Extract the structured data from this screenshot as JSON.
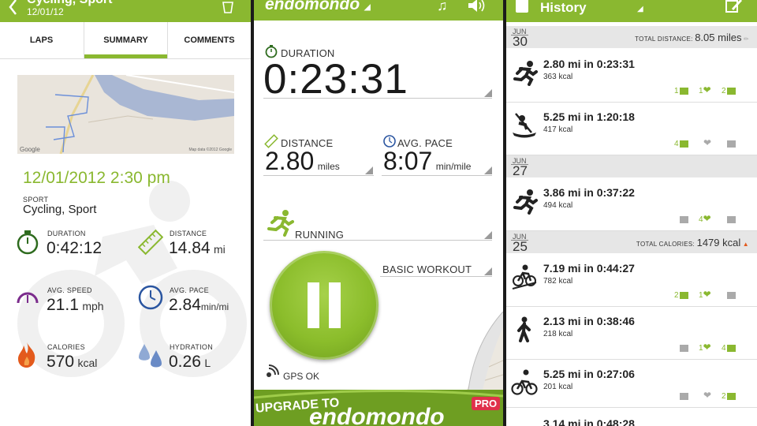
{
  "panel1": {
    "title": "Cycling, Sport",
    "subtitle": "12/01/12",
    "tabs": [
      "LAPS",
      "SUMMARY",
      "COMMENTS"
    ],
    "active_tab": "SUMMARY",
    "map_google_label": "Google",
    "map_copyright": "Map data ©2012 Google",
    "datetime": "12/01/2012 2:30 pm",
    "sport_label": "SPORT",
    "sport_value": "Cycling, Sport",
    "stats": {
      "duration": {
        "label": "DURATION",
        "value": "0:42:12",
        "unit": ""
      },
      "distance": {
        "label": "DISTANCE",
        "value": "14.84",
        "unit": "mi"
      },
      "avg_speed": {
        "label": "AVG. SPEED",
        "value": "21.1",
        "unit": "mph"
      },
      "avg_pace": {
        "label": "AVG. PACE",
        "value": "2.84",
        "unit": "min/mi"
      },
      "calories": {
        "label": "CALORIES",
        "value": "570",
        "unit": "kcal"
      },
      "hydration": {
        "label": "HYDRATION",
        "value": "0.26",
        "unit": "L"
      }
    }
  },
  "panel2": {
    "logo": "endomondo",
    "duration_label": "DURATION",
    "duration_value": "0:23:31",
    "distance_label": "DISTANCE",
    "distance_value": "2.80",
    "distance_unit": "miles",
    "pace_label": "AVG. PACE",
    "pace_value": "8:07",
    "pace_unit": "min/mile",
    "sport": "RUNNING",
    "workout": "BASIC WORKOUT",
    "gps": "GPS OK",
    "upgrade_text": "UPGRADE TO",
    "upgrade_logo": "endomondo",
    "pro_badge": "PRO"
  },
  "panel3": {
    "title": "History",
    "groups": [
      {
        "month": "JUN",
        "day": "30",
        "total_label": "TOTAL DISTANCE:",
        "total_value": "8.05 miles"
      },
      {
        "month": "JUN",
        "day": "27",
        "total_label": "",
        "total_value": ""
      },
      {
        "month": "JUN",
        "day": "25",
        "total_label": "TOTAL CALORIES:",
        "total_value": "1479 kcal"
      }
    ],
    "rows": [
      {
        "title": "2.80 mi in 0:23:31",
        "kcal": "363 kcal",
        "comments": "1",
        "likes": "1",
        "peptalks": "2",
        "icon": "running-icon"
      },
      {
        "title": "5.25 mi in 1:20:18",
        "kcal": "417 kcal",
        "comments": "4",
        "likes": "",
        "peptalks": "",
        "icon": "kayaking-icon"
      },
      {
        "title": "3.86 mi in 0:37:22",
        "kcal": "494 kcal",
        "comments": "",
        "likes": "4",
        "peptalks": "",
        "icon": "running-icon"
      },
      {
        "title": "7.19 mi in 0:44:27",
        "kcal": "782 kcal",
        "comments": "2",
        "likes": "1",
        "peptalks": "",
        "icon": "mountain-biking-icon"
      },
      {
        "title": "2.13 mi in 0:38:46",
        "kcal": "218 kcal",
        "comments": "",
        "likes": "1",
        "peptalks": "4",
        "icon": "walking-icon"
      },
      {
        "title": "5.25 mi in 0:27:06",
        "kcal": "201 kcal",
        "comments": "",
        "likes": "",
        "peptalks": "2",
        "icon": "cycling-icon"
      },
      {
        "title": "3.14 mi in 0:48:28",
        "kcal": "",
        "comments": "",
        "likes": "",
        "peptalks": "",
        "icon": "running-icon"
      }
    ]
  },
  "colors": {
    "accent": "#8ab830",
    "header_green": "#8ab830",
    "text": "#222222",
    "divider": "#dddddd"
  }
}
